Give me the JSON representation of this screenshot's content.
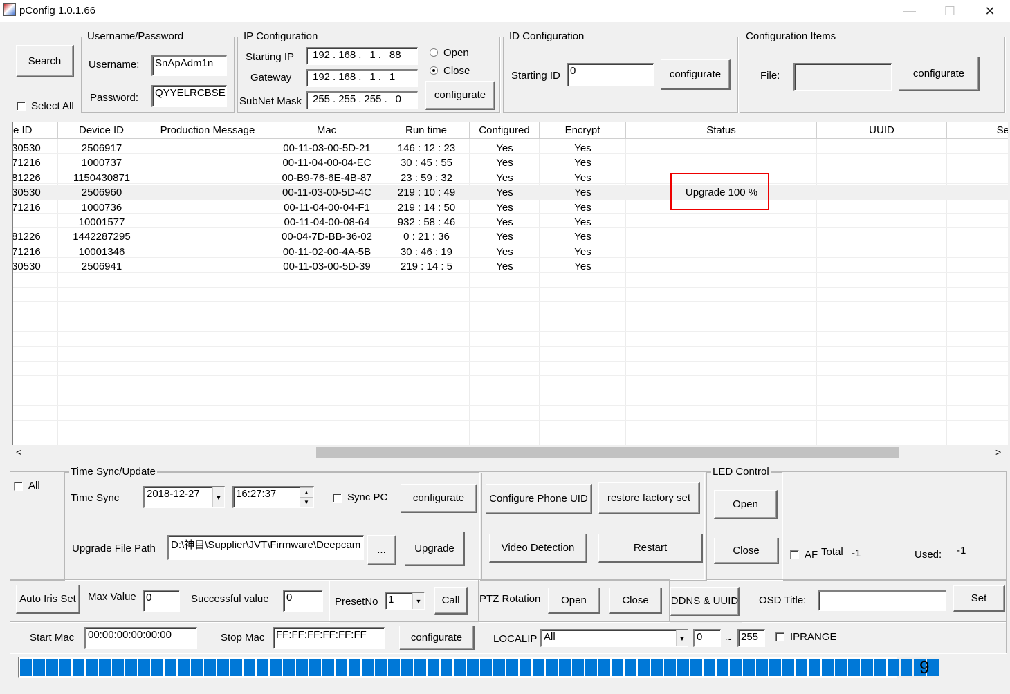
{
  "window": {
    "title": "pConfig  1.0.1.66",
    "minimize": "—",
    "maximize": "☐",
    "close": "✕"
  },
  "top": {
    "search_label": "Search",
    "select_all_label": "Select All",
    "userpass": {
      "group_title": "Username/Password",
      "username_label": "Username:",
      "username_value": "SnApAdm1n",
      "password_label": "Password:",
      "password_value": "QYYELRCBSE"
    },
    "ipconfig": {
      "group_title": "IP Configuration",
      "starting_ip_label": "Starting IP",
      "starting_ip": [
        "192",
        "168",
        "1",
        "88"
      ],
      "gateway_label": "Gateway",
      "gateway": [
        "192",
        "168",
        "1",
        "1"
      ],
      "subnet_label": "SubNet Mask",
      "subnet": [
        "255",
        "255",
        "255",
        "0"
      ],
      "open_label": "Open",
      "close_label": "Close",
      "selected": "Close",
      "configurate_label": "configurate"
    },
    "idconfig": {
      "group_title": "ID Configuration",
      "starting_id_label": "Starting ID",
      "starting_id_value": "0",
      "configurate_label": "configurate"
    },
    "items": {
      "group_title": "Configuration Items",
      "file_label": "File:",
      "file_value": "",
      "configurate_label": "configurate"
    }
  },
  "table": {
    "headers": [
      "e ID",
      "Device ID",
      "Production Message",
      "Mac",
      "Run time",
      "Configured",
      "Encrypt",
      "Status",
      "UUID",
      "Ser"
    ],
    "rows": [
      {
        "c0": "30530",
        "c1": "2506917",
        "c2": "",
        "c3": "00-11-03-00-5D-21",
        "c4": "146 : 12 : 23",
        "c5": "Yes",
        "c6": "Yes",
        "c7": ""
      },
      {
        "c0": "71216",
        "c1": "1000737",
        "c2": "",
        "c3": "00-11-04-00-04-EC",
        "c4": "30 : 45 : 55",
        "c5": "Yes",
        "c6": "Yes",
        "c7": ""
      },
      {
        "c0": "81226",
        "c1": "1150430871",
        "c2": "",
        "c3": "00-B9-76-6E-4B-87",
        "c4": "23 : 59 : 32",
        "c5": "Yes",
        "c6": "Yes",
        "c7": ""
      },
      {
        "c0": "30530",
        "c1": "2506960",
        "c2": "",
        "c3": "00-11-03-00-5D-4C",
        "c4": "219 : 10 : 49",
        "c5": "Yes",
        "c6": "Yes",
        "c7": "Upgrade 100 %"
      },
      {
        "c0": "71216",
        "c1": "1000736",
        "c2": "",
        "c3": "00-11-04-00-04-F1",
        "c4": "219 : 14 : 50",
        "c5": "Yes",
        "c6": "Yes",
        "c7": ""
      },
      {
        "c0": "",
        "c1": "10001577",
        "c2": "",
        "c3": "00-11-04-00-08-64",
        "c4": "932 : 58 : 46",
        "c5": "Yes",
        "c6": "Yes",
        "c7": ""
      },
      {
        "c0": "81226",
        "c1": "1442287295",
        "c2": "",
        "c3": "00-04-7D-BB-36-02",
        "c4": "0 : 21 : 36",
        "c5": "Yes",
        "c6": "Yes",
        "c7": ""
      },
      {
        "c0": "71216",
        "c1": "10001346",
        "c2": "",
        "c3": "00-11-02-00-4A-5B",
        "c4": "30 : 46 : 19",
        "c5": "Yes",
        "c6": "Yes",
        "c7": ""
      },
      {
        "c0": "30530",
        "c1": "2506941",
        "c2": "",
        "c3": "00-11-03-00-5D-39",
        "c4": "219 : 14 : 5",
        "c5": "Yes",
        "c6": "Yes",
        "c7": ""
      }
    ],
    "highlight_color": "#ee0000"
  },
  "bottom": {
    "all_label": "All",
    "timesync": {
      "group_title": "Time Sync/Update",
      "time_sync_label": "Time Sync",
      "date_value": "2018-12-27",
      "time_value": "16:27:37",
      "sync_pc_label": "Sync PC",
      "configurate_label": "configurate",
      "upgrade_path_label": "Upgrade File Path",
      "upgrade_path_value": "D:\\神目\\Supplier\\JVT\\Firmware\\Deepcam",
      "browse_label": "...",
      "upgrade_label": "Upgrade"
    },
    "configure_phone_uid": "Configure Phone UID",
    "restore_factory": "restore factory set",
    "video_detection": "Video Detection",
    "restart": "Restart",
    "led": {
      "group_title": "LED Control",
      "open_label": "Open",
      "close_label": "Close"
    },
    "af_label": "AF",
    "total_label": "Total",
    "total_value": "-1",
    "used_label": "Used:",
    "used_value": "-1",
    "auto_iris_label": "Auto Iris Set",
    "max_value_label": "Max Value",
    "max_value": "0",
    "successful_label": "Successful value",
    "successful_value": "0",
    "preset_label": "PresetNo",
    "preset_value": "1",
    "call_label": "Call",
    "ptz_label": "PTZ Rotation",
    "ptz_open": "Open",
    "ptz_close": "Close",
    "ddns_label": "DDNS & UUID",
    "osd_label": "OSD Title:",
    "osd_value": "",
    "set_label": "Set",
    "start_mac_label": "Start Mac",
    "start_mac_value": "00:00:00:00:00:00",
    "stop_mac_label": "Stop Mac",
    "stop_mac_value": "FF:FF:FF:FF:FF:FF",
    "mac_configurate_label": "configurate",
    "localip_label": "LOCALIP",
    "localip_value": "All",
    "range_from": "0",
    "range_sep": "~",
    "range_to": "255",
    "iprange_label": "IPRANGE",
    "progress_fraction": 1.0,
    "count": "9",
    "progress_color": "#0078d7"
  }
}
